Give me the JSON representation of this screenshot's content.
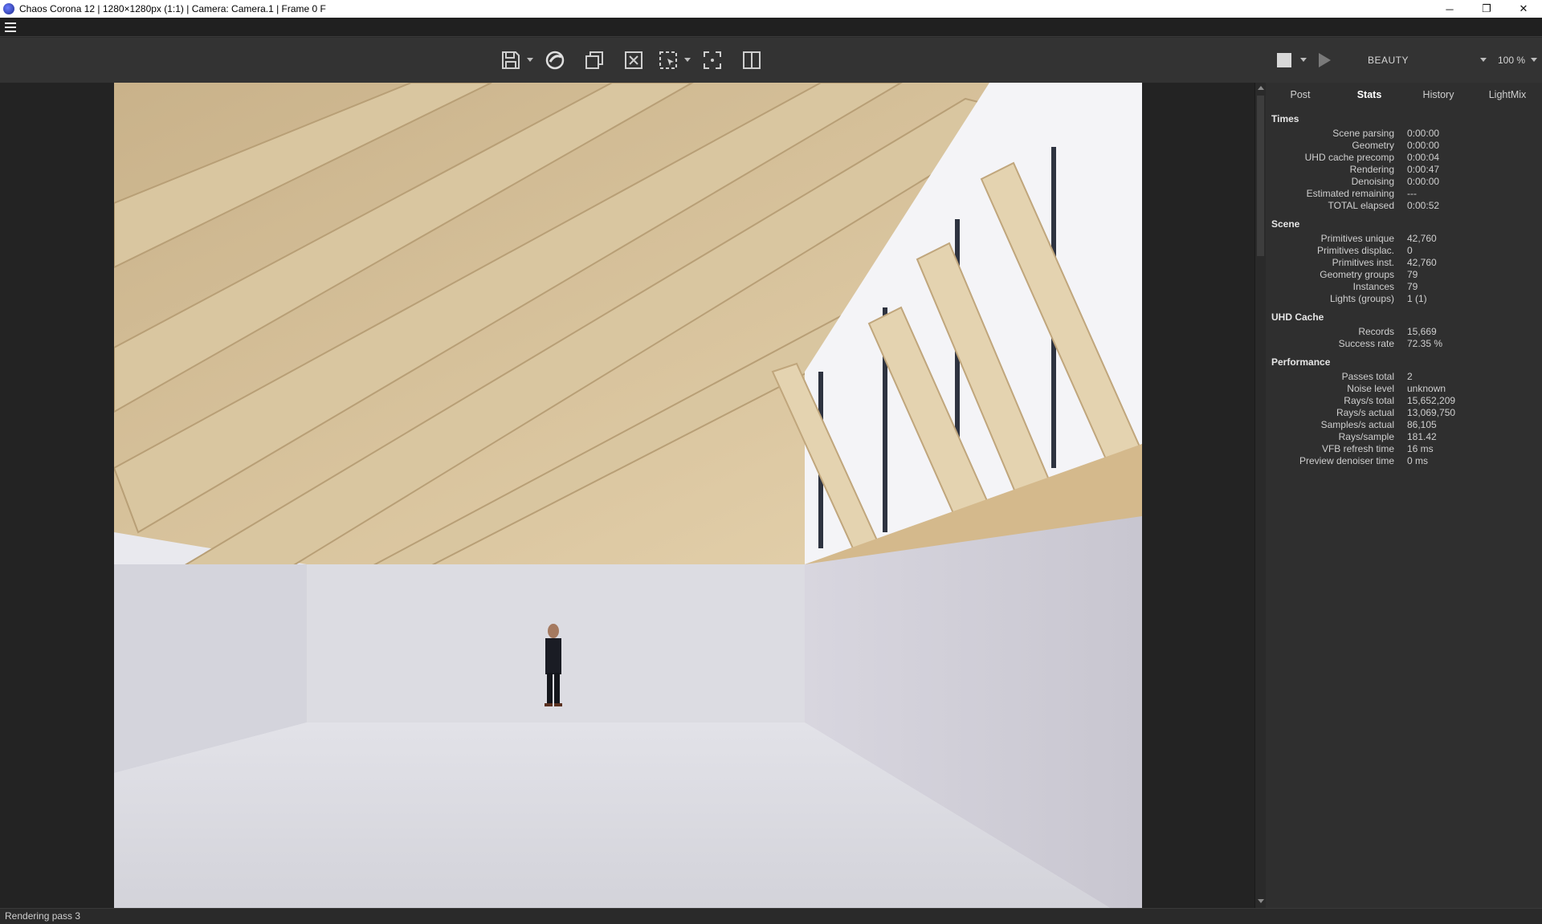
{
  "window": {
    "title": "Chaos Corona 12 | 1280×1280px (1:1) | Camera: Camera.1 | Frame 0 F",
    "minimize": "─",
    "restore": "❐",
    "close": "✕"
  },
  "toolbar": {
    "icons": [
      "save-icon",
      "corona-logo-icon",
      "copy-icon",
      "clear-icon",
      "region-select-icon",
      "focus-icon",
      "split-view-icon"
    ]
  },
  "render_controls": {
    "channel": "BEAUTY",
    "zoom": "100 %"
  },
  "panel": {
    "tabs": [
      "Post",
      "Stats",
      "History",
      "LightMix"
    ],
    "active_tab": "Stats",
    "sections": [
      {
        "title": "Times",
        "rows": [
          {
            "k": "Scene parsing",
            "v": "0:00:00"
          },
          {
            "k": "Geometry",
            "v": "0:00:00"
          },
          {
            "k": "UHD cache precomp",
            "v": "0:00:04"
          },
          {
            "k": "Rendering",
            "v": "0:00:47"
          },
          {
            "k": "Denoising",
            "v": "0:00:00"
          },
          {
            "k": "Estimated remaining",
            "v": "---"
          },
          {
            "k": "TOTAL elapsed",
            "v": "0:00:52"
          }
        ]
      },
      {
        "title": "Scene",
        "rows": [
          {
            "k": "Primitives unique",
            "v": "42,760"
          },
          {
            "k": "Primitives displac.",
            "v": "0"
          },
          {
            "k": "Primitives inst.",
            "v": "42,760"
          },
          {
            "k": "Geometry groups",
            "v": "79"
          },
          {
            "k": "Instances",
            "v": "79"
          },
          {
            "k": "Lights (groups)",
            "v": "1 (1)"
          }
        ]
      },
      {
        "title": "UHD Cache",
        "rows": [
          {
            "k": "Records",
            "v": "15,669"
          },
          {
            "k": "Success rate",
            "v": "72.35 %"
          }
        ]
      },
      {
        "title": "Performance",
        "rows": [
          {
            "k": "Passes total",
            "v": "2"
          },
          {
            "k": "Noise level",
            "v": "unknown"
          },
          {
            "k": "Rays/s total",
            "v": "15,652,209"
          },
          {
            "k": "Rays/s actual",
            "v": "13,069,750"
          },
          {
            "k": "Samples/s actual",
            "v": "86,105"
          },
          {
            "k": "Rays/sample",
            "v": "181.42"
          },
          {
            "k": "VFB refresh time",
            "v": "16 ms"
          },
          {
            "k": "Preview denoiser time",
            "v": "0 ms"
          }
        ]
      }
    ]
  },
  "status": {
    "text": "Rendering pass 3"
  }
}
